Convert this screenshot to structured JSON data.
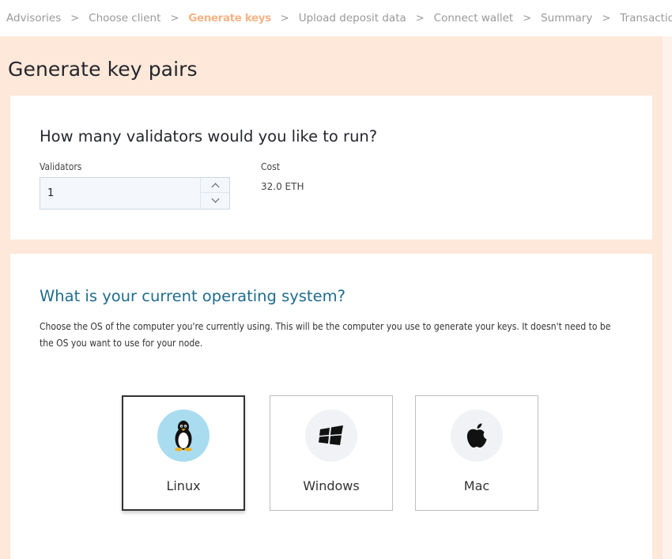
{
  "breadcrumb": {
    "steps": [
      "Advisories",
      "Choose client",
      "Generate keys",
      "Upload deposit data",
      "Connect wallet",
      "Summary",
      "Transactions"
    ],
    "active_index": 2,
    "separator": ">"
  },
  "page": {
    "title": "Generate key pairs"
  },
  "validators_card": {
    "question": "How many validators would you like to run?",
    "validators_label": "Validators",
    "validators_value": "1",
    "cost_label": "Cost",
    "cost_value": "32.0 ETH"
  },
  "os_card": {
    "question": "What is your current operating system?",
    "description": "Choose the OS of the computer you're currently using. This will be the computer you use to generate your keys. It doesn't need to be the OS you want to use for your node.",
    "options": [
      {
        "label": "Linux",
        "icon": "linux-penguin-icon",
        "selected": true
      },
      {
        "label": "Windows",
        "icon": "windows-logo-icon",
        "selected": false
      },
      {
        "label": "Mac",
        "icon": "apple-logo-icon",
        "selected": false
      }
    ]
  },
  "colors": {
    "active_step": "#f6b486",
    "page_background": "#fde8da",
    "os_question": "#1f6c8e",
    "selected_icon_bg": "#a9dcef"
  }
}
